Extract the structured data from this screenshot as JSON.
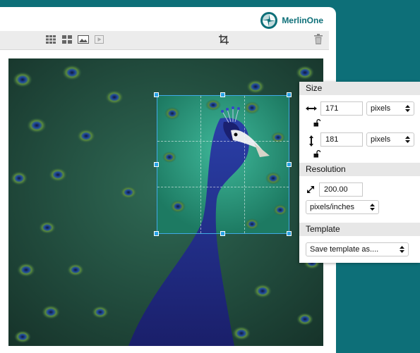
{
  "brand": {
    "name": "MerlinOne"
  },
  "toolbar": {
    "icons": [
      "grid-view-icon",
      "list-view-icon",
      "image-view-icon",
      "video-play-icon",
      "crop-icon",
      "trash-icon"
    ]
  },
  "crop_panel": {
    "size": {
      "header": "Size",
      "width_value": "171",
      "width_unit": "pixels",
      "height_value": "181",
      "height_unit": "pixels"
    },
    "resolution": {
      "header": "Resolution",
      "value": "200.00",
      "unit": "pixels/inches"
    },
    "template": {
      "header": "Template",
      "select_label": "Save template as...."
    }
  },
  "colors": {
    "background": "#0d6f78",
    "brand": "#0d6f78",
    "crop_handle": "#29a3e6"
  }
}
